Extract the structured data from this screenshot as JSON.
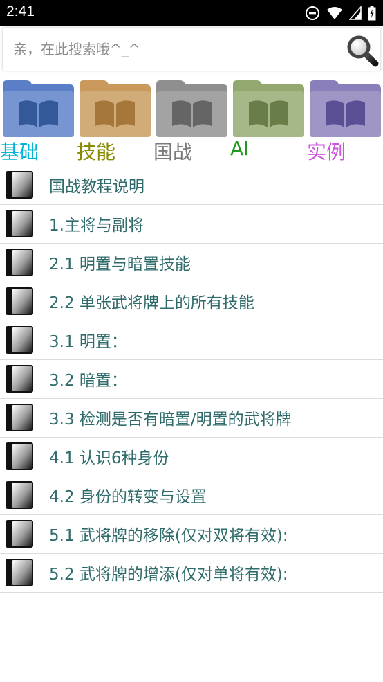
{
  "status_bar": {
    "time": "2:41"
  },
  "search": {
    "placeholder": "亲，在此搜索哦^_^"
  },
  "categories": [
    {
      "label": "基础",
      "color": "#00b4d8",
      "folder_color": "#5a7fc7"
    },
    {
      "label": "技能",
      "color": "#8a8a00",
      "folder_color": "#c99a5b"
    },
    {
      "label": "国战",
      "color": "#7a7a7a",
      "folder_color": "#8f8f8f"
    },
    {
      "label": "AI",
      "color": "#1e9a1e",
      "folder_color": "#93a86e"
    },
    {
      "label": "实例",
      "color": "#cc55dd",
      "folder_color": "#8a7fba"
    }
  ],
  "list": {
    "items": [
      "国战教程说明",
      "1.主将与副将",
      "2.1 明置与暗置技能",
      "2.2 单张武将牌上的所有技能",
      "3.1 明置：",
      "3.2 暗置：",
      "3.3 检测是否有暗置/明置的武将牌",
      "4.1 认识6种身份",
      "4.2 身份的转变与设置",
      "5.1 武将牌的移除(仅对双将有效):",
      "5.2 武将牌的增添(仅对单将有效):"
    ]
  }
}
